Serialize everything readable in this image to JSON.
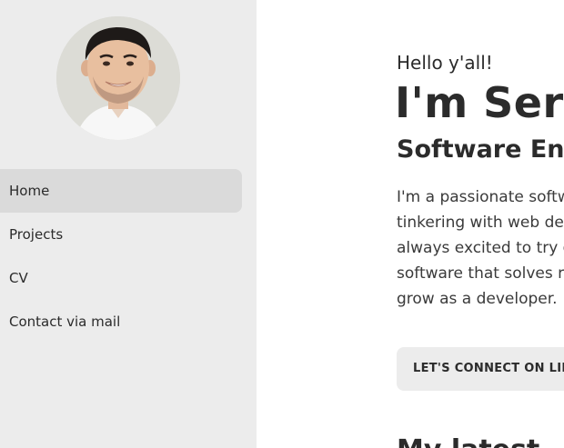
{
  "sidebar": {
    "avatar_alt": "profile photo",
    "nav": [
      {
        "label": "Home",
        "active": true
      },
      {
        "label": "Projects",
        "active": false
      },
      {
        "label": "CV",
        "active": false
      },
      {
        "label": "Contact via mail",
        "active": false
      }
    ]
  },
  "hero": {
    "greeting": "Hello y'all!",
    "name": "I'm Serd",
    "role": "Software Eng",
    "bio_lines": [
      "I'm a passionate softwa",
      "tinkering with web deve",
      "always excited to try ou",
      "software that solves rea",
      "grow as a developer."
    ],
    "cta_label": "LET'S CONNECT ON LINKE",
    "next_heading": "My latest ..."
  },
  "colors": {
    "sidebar_bg": "#ececec",
    "nav_active_bg": "#dadada",
    "text": "#2b2b2b"
  }
}
